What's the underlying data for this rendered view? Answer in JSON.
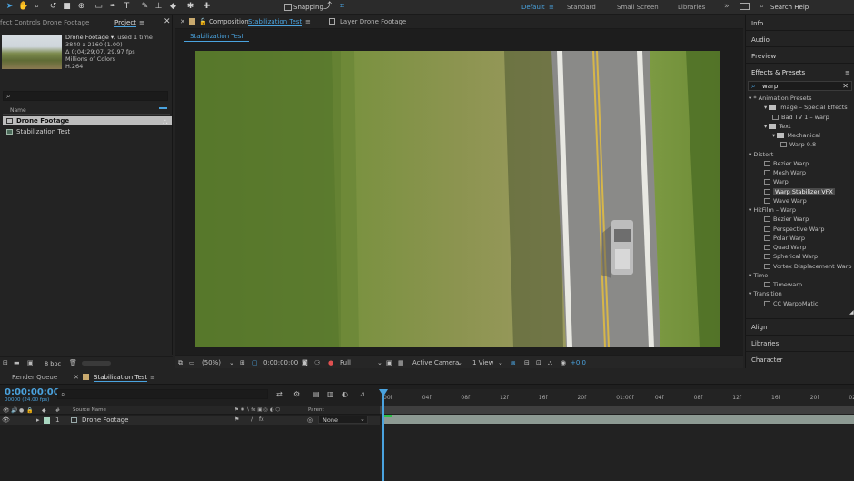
{
  "toolbar": {
    "snapping_label": "Snapping",
    "workspaces": [
      "Default",
      "Standard",
      "Small Screen",
      "Libraries"
    ],
    "active_workspace": "Default",
    "search_placeholder": "Search Help"
  },
  "project_panel": {
    "effect_controls_tab": "fect Controls Drone Footage",
    "project_tab": "Project",
    "footage": {
      "name": "Drone Footage ▾",
      "used": ", used 1 time",
      "resolution": "3840 x 2160 (1.00)",
      "duration": "Δ 0;04;29;07, 29.97 fps",
      "colors": "Millions of Colors",
      "codec": "H.264"
    },
    "column_name": "Name",
    "items": [
      "Drone Footage",
      "Stabilization Test"
    ],
    "bpc": "8 bpc"
  },
  "composition": {
    "tab_prefix": "Composition",
    "tab_name": "Stabilization Test",
    "layer_tab": "Layer Drone Footage",
    "sub_tab": "Stabilization Test",
    "zoom": "(50%)",
    "timecode": "0:00:00:00",
    "resolution": "Full",
    "camera": "Active Camera",
    "views": "1 View",
    "exposure": "+0.0"
  },
  "right_panel": {
    "sections_top": [
      "Info",
      "Audio",
      "Preview",
      "Effects & Presets"
    ],
    "search_value": "warp",
    "tree": [
      {
        "label": "* Animation Presets",
        "level": 0,
        "type": "group"
      },
      {
        "label": "Image – Special Effects",
        "level": 1,
        "type": "folder"
      },
      {
        "label": "Bad TV 1 – warp",
        "level": 2,
        "type": "item"
      },
      {
        "label": "Text",
        "level": 1,
        "type": "folder"
      },
      {
        "label": "Mechanical",
        "level": 2,
        "type": "folder"
      },
      {
        "label": "Warp 9.8",
        "level": 3,
        "type": "item"
      },
      {
        "label": "Distort",
        "level": 0,
        "type": "group"
      },
      {
        "label": "Bezier Warp",
        "level": 1,
        "type": "item"
      },
      {
        "label": "Mesh Warp",
        "level": 1,
        "type": "item"
      },
      {
        "label": "Warp",
        "level": 1,
        "type": "item"
      },
      {
        "label": "Warp Stabilizer VFX",
        "level": 1,
        "type": "item",
        "selected": true
      },
      {
        "label": "Wave Warp",
        "level": 1,
        "type": "item"
      },
      {
        "label": "HitFilm – Warp",
        "level": 0,
        "type": "group"
      },
      {
        "label": "Bezier Warp",
        "level": 1,
        "type": "item"
      },
      {
        "label": "Perspective Warp",
        "level": 1,
        "type": "item"
      },
      {
        "label": "Polar Warp",
        "level": 1,
        "type": "item"
      },
      {
        "label": "Quad Warp",
        "level": 1,
        "type": "item"
      },
      {
        "label": "Spherical Warp",
        "level": 1,
        "type": "item"
      },
      {
        "label": "Vortex Displacement Warp",
        "level": 1,
        "type": "item"
      },
      {
        "label": "Time",
        "level": 0,
        "type": "group"
      },
      {
        "label": "Timewarp",
        "level": 1,
        "type": "item"
      },
      {
        "label": "Transition",
        "level": 0,
        "type": "group"
      },
      {
        "label": "CC WarpoMatic",
        "level": 1,
        "type": "item"
      }
    ],
    "sections_bottom": [
      "Align",
      "Libraries",
      "Character"
    ]
  },
  "timeline": {
    "render_queue_tab": "Render Queue",
    "comp_tab": "Stabilization Test",
    "timecode": "0:00:00:00",
    "fps": "00000 (24.00 fps)",
    "col_source": "Source Name",
    "col_parent": "Parent",
    "layer_number": "1",
    "layer_name": "Drone Footage",
    "parent_value": "None",
    "ruler_ticks": [
      "00f",
      "04f",
      "08f",
      "12f",
      "16f",
      "20f",
      "01:00f",
      "04f",
      "08f",
      "12f",
      "16f",
      "20f",
      "02:0"
    ]
  },
  "colors": {
    "accent": "#4aa3df",
    "panel_bg": "#232323",
    "track": "#8d9a93"
  }
}
